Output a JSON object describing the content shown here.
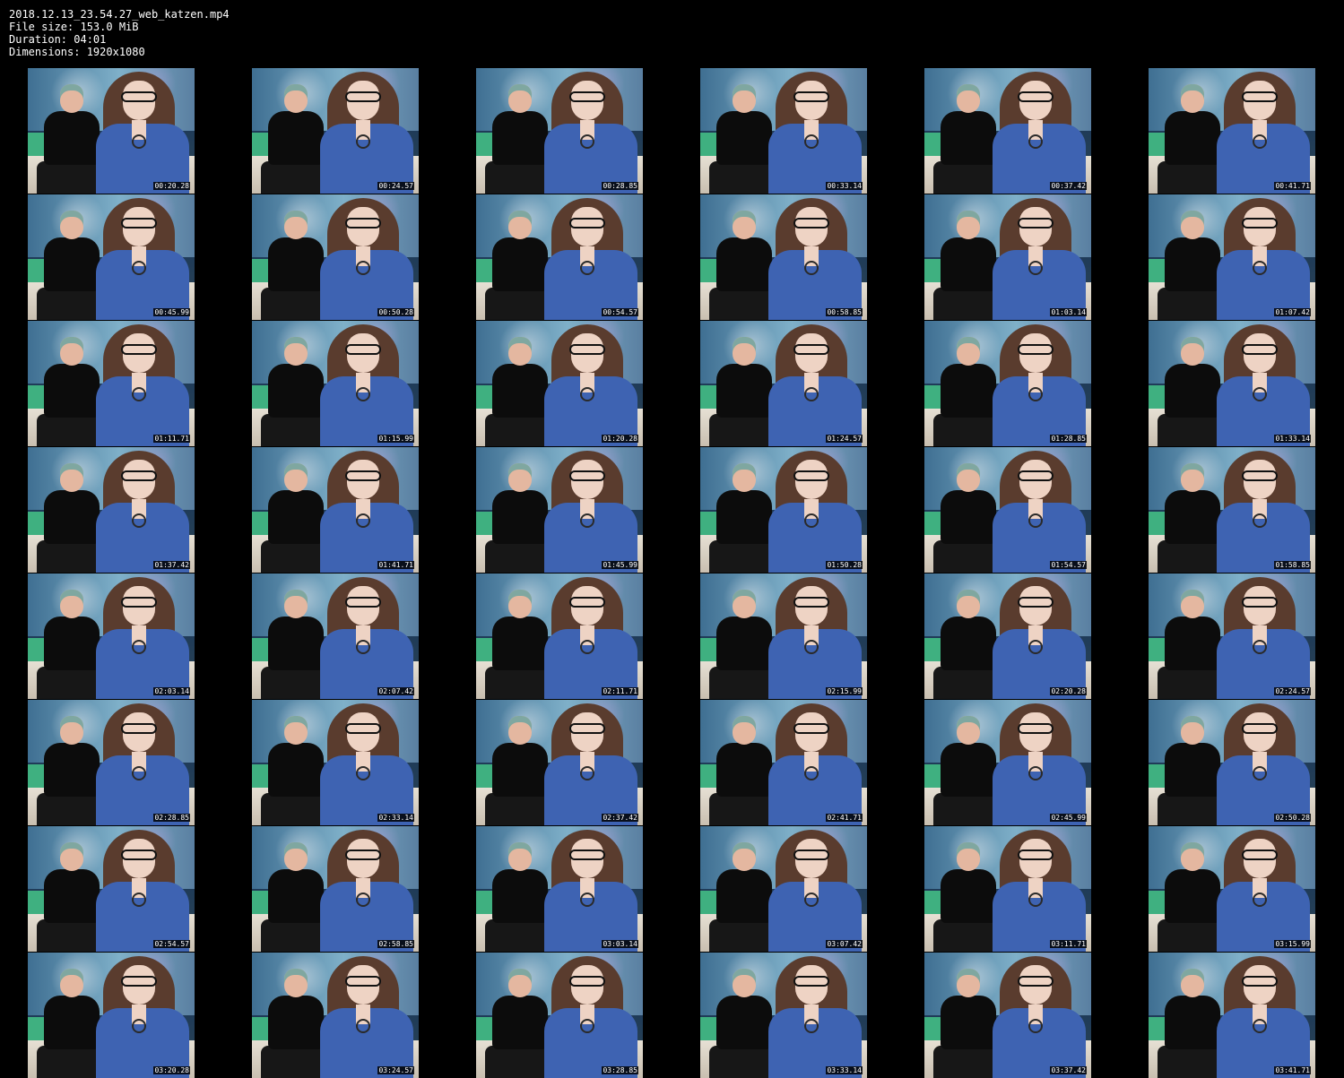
{
  "header": {
    "filename": "2018.12.13_23.54.27_web_katzen.mp4",
    "file_size": "File size: 153.0 MiB",
    "duration": "Duration: 04:01",
    "dimensions": "Dimensions: 1920x1080"
  },
  "thumbnails": [
    "00:20.28",
    "00:24.57",
    "00:28.85",
    "00:33.14",
    "00:37.42",
    "00:41.71",
    "00:45.99",
    "00:50.28",
    "00:54.57",
    "00:58.85",
    "01:03.14",
    "01:07.42",
    "01:11.71",
    "01:15.99",
    "01:20.28",
    "01:24.57",
    "01:28.85",
    "01:33.14",
    "01:37.42",
    "01:41.71",
    "01:45.99",
    "01:50.28",
    "01:54.57",
    "01:58.85",
    "02:03.14",
    "02:07.42",
    "02:11.71",
    "02:15.99",
    "02:20.28",
    "02:24.57",
    "02:28.85",
    "02:33.14",
    "02:37.42",
    "02:41.71",
    "02:45.99",
    "02:50.28",
    "02:54.57",
    "02:58.85",
    "03:03.14",
    "03:07.42",
    "03:11.71",
    "03:15.99",
    "03:20.28",
    "03:24.57",
    "03:28.85",
    "03:33.14",
    "03:37.42",
    "03:41.71"
  ]
}
